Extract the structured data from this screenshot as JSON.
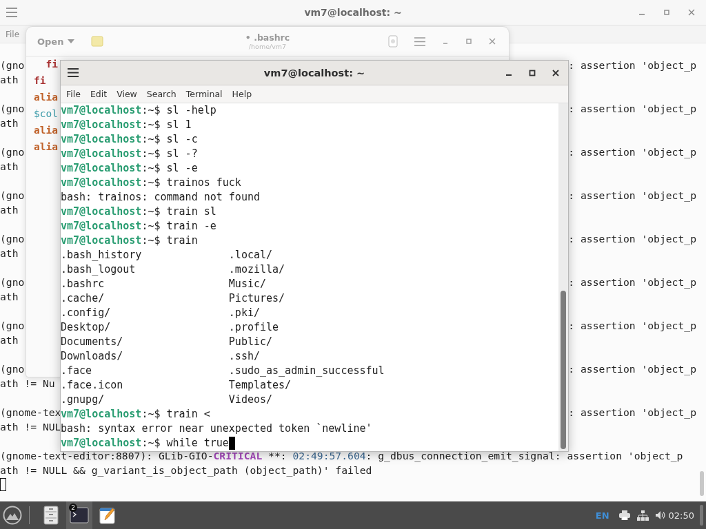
{
  "background_terminal": {
    "title": "vm7@localhost: ~",
    "menu": [
      "File"
    ],
    "cursor": true,
    "messages": [
      {
        "line_1": {
          "start": "(gno",
          "end": ": assertion 'object_p"
        },
        "line_2": {
          "start": "ath"
        }
      },
      {
        "line_1": {
          "start": "(gno",
          "end": ": assertion 'object_p"
        },
        "line_2": {
          "start": "ath"
        }
      },
      {
        "line_1": {
          "start": "(gno",
          "end": ": assertion 'object_p"
        },
        "line_2": {
          "start": "ath"
        }
      },
      {
        "line_1": {
          "start": "(gno",
          "end": ": assertion 'object_p"
        },
        "line_2": {
          "start": "ath"
        }
      },
      {
        "line_1": {
          "start": "(gno",
          "end": ": assertion 'object_p"
        },
        "line_2": {
          "start": "ath"
        }
      },
      {
        "line_1": {
          "start": "(gno",
          "end": ": assertion 'object_p"
        },
        "line_2": {
          "start": "ath"
        }
      },
      {
        "line_1": {
          "start": "(gno",
          "end": ": assertion 'object_p"
        },
        "line_2": {
          "start": "ath"
        }
      },
      {
        "line_1": {
          "start": "(gno",
          "end": ": assertion 'object_p"
        },
        "line_2": {
          "start": "ath != Nu"
        }
      },
      {
        "line_1": {
          "start": "(gnome-tex",
          "end": ": assertion 'object_p"
        },
        "line_2": {
          "start": "ath != NUL"
        }
      },
      {
        "line_1": {
          "segments": [
            {
              "kind": "plain",
              "text": "(gnome-text-editor:8807): GLib-GIO-"
            },
            {
              "kind": "level",
              "text": "CRITICAL"
            },
            {
              "kind": "plain",
              "text": " **: "
            },
            {
              "kind": "time",
              "text": "02:49:57.604"
            },
            {
              "kind": "plain",
              "text": ": g_dbus_connection_emit_signal: assertion 'object_p"
            }
          ]
        },
        "line_2": {
          "start": "ath != NULL && g_variant_is_object_path (object_path)' failed"
        }
      }
    ]
  },
  "text_editor": {
    "open_button": "Open",
    "title": "• .bashrc",
    "subtitle": "/home/vm7",
    "code_lines": [
      {
        "kind": "keyword",
        "text": "  fi"
      },
      {
        "kind": "keyword",
        "text": "fi"
      },
      {
        "kind": "builtin",
        "text": "alia"
      },
      {
        "kind": "variable",
        "text": "$col"
      },
      {
        "kind": "builtin",
        "text": "alia"
      },
      {
        "kind": "builtin",
        "text": "alia"
      }
    ]
  },
  "terminal": {
    "title": "vm7@localhost: ~",
    "menu": [
      "File",
      "Edit",
      "View",
      "Search",
      "Terminal",
      "Help"
    ],
    "lines": [
      {
        "kind": "prompt",
        "user_host": "vm7@localhost",
        "suffix": ":~$",
        "command": "sl -help",
        "cursor": false
      },
      {
        "kind": "prompt",
        "user_host": "vm7@localhost",
        "suffix": ":~$",
        "command": "sl 1",
        "cursor": false
      },
      {
        "kind": "prompt",
        "user_host": "vm7@localhost",
        "suffix": ":~$",
        "command": "sl -c",
        "cursor": false
      },
      {
        "kind": "prompt",
        "user_host": "vm7@localhost",
        "suffix": ":~$",
        "command": "sl -?",
        "cursor": false
      },
      {
        "kind": "prompt",
        "user_host": "vm7@localhost",
        "suffix": ":~$",
        "command": "sl -e",
        "cursor": false
      },
      {
        "kind": "prompt",
        "user_host": "vm7@localhost",
        "suffix": ":~$",
        "command": "trainos fuck",
        "cursor": false
      },
      {
        "kind": "output",
        "text": "bash: trainos: command not found"
      },
      {
        "kind": "prompt",
        "user_host": "vm7@localhost",
        "suffix": ":~$",
        "command": "train sl",
        "cursor": false
      },
      {
        "kind": "prompt",
        "user_host": "vm7@localhost",
        "suffix": ":~$",
        "command": "train -e",
        "cursor": false
      },
      {
        "kind": "prompt",
        "user_host": "vm7@localhost",
        "suffix": ":~$",
        "command": "train",
        "cursor": false
      },
      {
        "kind": "columns",
        "left": ".bash_history",
        "right": ".local/"
      },
      {
        "kind": "columns",
        "left": ".bash_logout",
        "right": ".mozilla/"
      },
      {
        "kind": "columns",
        "left": ".bashrc",
        "right": "Music/"
      },
      {
        "kind": "columns",
        "left": ".cache/",
        "right": "Pictures/"
      },
      {
        "kind": "columns",
        "left": ".config/",
        "right": ".pki/"
      },
      {
        "kind": "columns",
        "left": "Desktop/",
        "right": ".profile"
      },
      {
        "kind": "columns",
        "left": "Documents/",
        "right": "Public/"
      },
      {
        "kind": "columns",
        "left": "Downloads/",
        "right": ".ssh/"
      },
      {
        "kind": "columns",
        "left": ".face",
        "right": ".sudo_as_admin_successful"
      },
      {
        "kind": "columns",
        "left": ".face.icon",
        "right": "Templates/"
      },
      {
        "kind": "columns",
        "left": ".gnupg/",
        "right": "Videos/"
      },
      {
        "kind": "prompt",
        "user_host": "vm7@localhost",
        "suffix": ":~$",
        "command": "train <",
        "cursor": false
      },
      {
        "kind": "output",
        "text": "bash: syntax error near unexpected token `newline'"
      },
      {
        "kind": "prompt",
        "user_host": "vm7@localhost",
        "suffix": ":~$",
        "command": "while true",
        "cursor": true
      }
    ]
  },
  "taskbar": {
    "apps": [
      {
        "kind": "files",
        "selected": false
      },
      {
        "kind": "terminal",
        "selected": true,
        "badge": "2"
      },
      {
        "kind": "editor",
        "selected": false
      }
    ],
    "language": "EN",
    "clock": "02:50"
  }
}
